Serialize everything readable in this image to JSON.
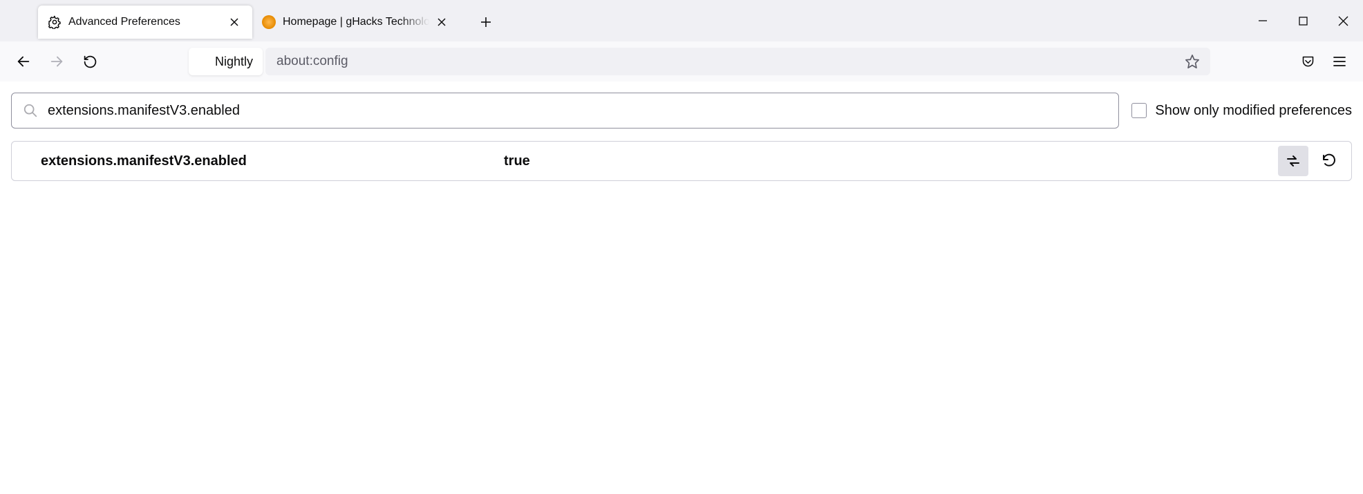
{
  "tabs": [
    {
      "title": "Advanced Preferences",
      "active": true
    },
    {
      "title": "Homepage | gHacks Technology News",
      "active": false
    }
  ],
  "identity_label": "Nightly",
  "url": "about:config",
  "search": {
    "value": "extensions.manifestV3.enabled"
  },
  "checkbox_label": "Show only modified preferences",
  "preference": {
    "name": "extensions.manifestV3.enabled",
    "value": "true"
  }
}
